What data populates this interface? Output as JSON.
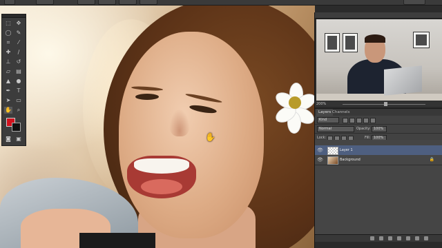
{
  "photo": {
    "subject": "photo-smiling-woman"
  },
  "toolbar": {
    "icons": [
      "move-icon",
      "marquee-icon",
      "lasso-icon",
      "quick-select-icon",
      "crop-icon",
      "eyedropper-icon",
      "healing-icon",
      "brush-icon",
      "stamp-icon",
      "history-brush-icon",
      "eraser-icon",
      "gradient-icon",
      "blur-icon",
      "dodge-icon",
      "pen-icon",
      "type-icon",
      "path-select-icon",
      "shape-icon",
      "hand-icon",
      "zoom-icon"
    ]
  },
  "colors": {
    "foreground": "#d1121d",
    "background": "#111111",
    "active_layer": "#4e5f80"
  },
  "navigator": {
    "zoom": "200%"
  },
  "panel": {
    "tabs": [
      "Layers",
      "Channels"
    ],
    "filter": "Kind",
    "blend_mode": "Normal",
    "opacity_label": "Opacity:",
    "opacity_value": "100%",
    "lock_label": "Lock:",
    "fill_label": "Fill:",
    "fill_value": "100%"
  },
  "layers": [
    {
      "name": "Layer 1",
      "visible": true,
      "selected": true
    },
    {
      "name": "Background",
      "visible": true,
      "selected": false,
      "locked": true
    }
  ]
}
